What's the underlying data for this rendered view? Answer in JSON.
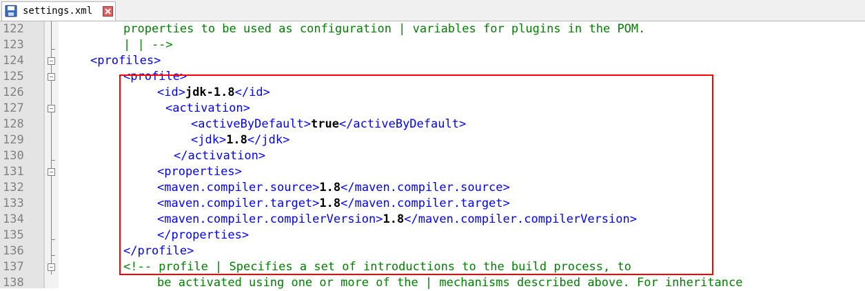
{
  "tab": {
    "title": "settings.xml",
    "save_icon": "floppy-disk-icon",
    "close_icon": "close-icon"
  },
  "colors": {
    "tag": "#0000ff",
    "comment": "#008000",
    "value": "#000000",
    "highlight": "#ff0000",
    "line_number": "#808080"
  },
  "lines": [
    {
      "num": "122",
      "parts": [
        {
          "c": "comment",
          "t": "properties to be used as configuration | variables for plugins in the POM."
        }
      ]
    },
    {
      "num": "123",
      "parts": [
        {
          "c": "comment",
          "t": "| | -->"
        }
      ]
    },
    {
      "num": "124",
      "parts": [
        {
          "c": "tag",
          "t": "<profiles>"
        }
      ]
    },
    {
      "num": "125",
      "parts": [
        {
          "c": "tag",
          "t": "<profile>"
        }
      ]
    },
    {
      "num": "126",
      "parts": [
        {
          "c": "tag",
          "t": "<id>"
        },
        {
          "c": "val",
          "t": "jdk-1.8"
        },
        {
          "c": "tag",
          "t": "</id>"
        }
      ]
    },
    {
      "num": "127",
      "parts": [
        {
          "c": "tag",
          "t": "<activation>"
        }
      ]
    },
    {
      "num": "128",
      "parts": [
        {
          "c": "tag",
          "t": "<activeByDefault>"
        },
        {
          "c": "val",
          "t": "true"
        },
        {
          "c": "tag",
          "t": "</activeByDefault>"
        }
      ]
    },
    {
      "num": "129",
      "parts": [
        {
          "c": "tag",
          "t": "<jdk>"
        },
        {
          "c": "val",
          "t": "1.8"
        },
        {
          "c": "tag",
          "t": "</jdk>"
        }
      ]
    },
    {
      "num": "130",
      "parts": [
        {
          "c": "tag",
          "t": "</activation>"
        }
      ]
    },
    {
      "num": "131",
      "parts": [
        {
          "c": "tag",
          "t": "<properties>"
        }
      ]
    },
    {
      "num": "132",
      "parts": [
        {
          "c": "tag",
          "t": "<maven.compiler.source>"
        },
        {
          "c": "val",
          "t": "1.8"
        },
        {
          "c": "tag",
          "t": "</maven.compiler.source>"
        }
      ]
    },
    {
      "num": "133",
      "parts": [
        {
          "c": "tag",
          "t": "<maven.compiler.target>"
        },
        {
          "c": "val",
          "t": "1.8"
        },
        {
          "c": "tag",
          "t": "</maven.compiler.target>"
        }
      ]
    },
    {
      "num": "134",
      "parts": [
        {
          "c": "tag",
          "t": "<maven.compiler.compilerVersion>"
        },
        {
          "c": "val",
          "t": "1.8"
        },
        {
          "c": "tag",
          "t": "</maven.compiler.compilerVersion>"
        }
      ]
    },
    {
      "num": "135",
      "parts": [
        {
          "c": "tag",
          "t": "</properties>"
        }
      ]
    },
    {
      "num": "136",
      "parts": [
        {
          "c": "tag",
          "t": "</profile>"
        }
      ]
    },
    {
      "num": "137",
      "parts": [
        {
          "c": "comment",
          "t": "<!-- profile | Specifies a set of introductions to the build process, to"
        }
      ]
    },
    {
      "num": "138",
      "parts": [
        {
          "c": "comment",
          "t": "be activated using one or more of the | mechanisms described above. For inheritance"
        }
      ]
    }
  ]
}
